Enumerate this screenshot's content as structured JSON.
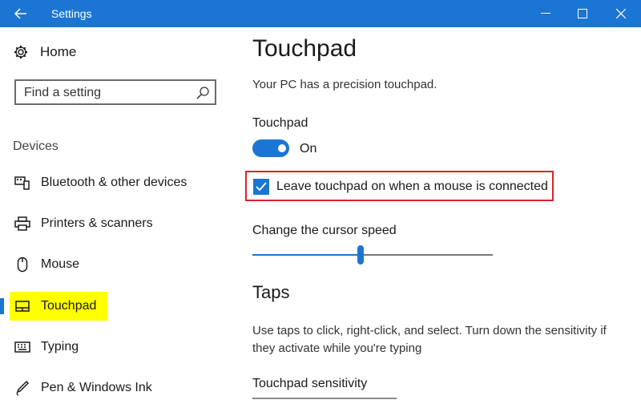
{
  "window": {
    "title": "Settings",
    "accent_color": "#1a76d2"
  },
  "sidebar": {
    "home_label": "Home",
    "search_placeholder": "Find a setting",
    "section_label": "Devices",
    "items": [
      {
        "label": "Bluetooth & other devices",
        "icon": "bluetooth-devices-icon"
      },
      {
        "label": "Printers & scanners",
        "icon": "printer-icon"
      },
      {
        "label": "Mouse",
        "icon": "mouse-icon"
      },
      {
        "label": "Touchpad",
        "icon": "touchpad-icon",
        "active": true,
        "highlight_color": "#ffff00"
      },
      {
        "label": "Typing",
        "icon": "keyboard-icon"
      },
      {
        "label": "Pen & Windows Ink",
        "icon": "pen-icon"
      }
    ]
  },
  "main": {
    "title": "Touchpad",
    "subtitle": "Your PC has a precision touchpad.",
    "toggle": {
      "label": "Touchpad",
      "state": "On",
      "on": true
    },
    "checkbox": {
      "label": "Leave touchpad on when a mouse is connected",
      "checked": true,
      "outline_color": "#d9232b"
    },
    "cursor_speed": {
      "label": "Change the cursor speed",
      "value_fraction": 0.45
    },
    "taps": {
      "heading": "Taps",
      "description": "Use taps to click, right-click, and select. Turn down the sensitivity if they activate while you're typing",
      "sensitivity_label": "Touchpad sensitivity"
    }
  }
}
